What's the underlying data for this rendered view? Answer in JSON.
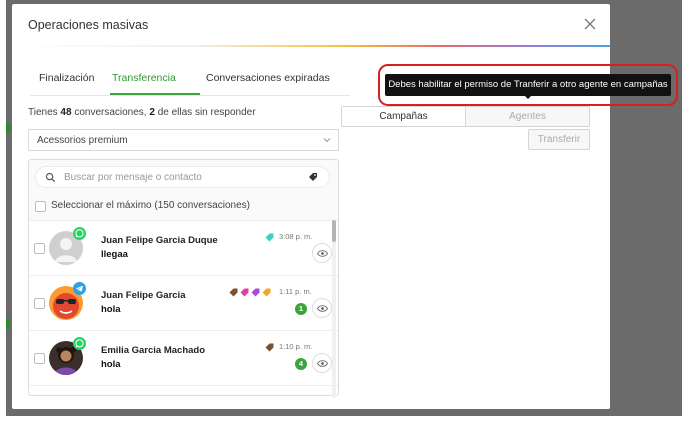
{
  "modal": {
    "title": "Operaciones masivas",
    "close_icon": "close-icon"
  },
  "tabs": [
    {
      "label": "Finalización",
      "active": false
    },
    {
      "label": "Transferencia",
      "active": true
    },
    {
      "label": "Conversaciones expiradas",
      "active": false
    }
  ],
  "summary": {
    "prefix": "Tienes ",
    "total": "48",
    "middle": " conversaciones, ",
    "unanswered": "2",
    "suffix": " de ellas sin responder"
  },
  "filter": {
    "selected": "Acessorios premium"
  },
  "search": {
    "placeholder": "Buscar por mensaje o contacto"
  },
  "select_all": {
    "label": "Seleccionar el máximo (150 conversaciones)"
  },
  "conversations": [
    {
      "name": "Juan Felipe Garcia Duque",
      "message": "llegaa",
      "time": "3:08 p. m.",
      "unread": "",
      "channel": "whatsapp",
      "avatar": "default-avatar",
      "tags": [
        "#3fd1c8"
      ]
    },
    {
      "name": "Juan Felipe Garcia",
      "message": "hola",
      "time": "1:11 p. m.",
      "unread": "1",
      "channel": "telegram",
      "avatar": "sunglasses-avatar",
      "tags": [
        "#7a5230",
        "#e040a0",
        "#a54be0",
        "#f2a623"
      ]
    },
    {
      "name": "Emilia Garcia Machado",
      "message": "hola",
      "time": "1:10 p. m.",
      "unread": "4",
      "channel": "whatsapp",
      "avatar": "photo-avatar",
      "tags": [
        "#7a5230"
      ]
    }
  ],
  "transfer": {
    "segment_campaigns": "Campañas",
    "segment_agents": "Agentes",
    "button": "Transferir",
    "tooltip": "Debes habilitar el permiso de Tranferir a otro agente en campañas"
  },
  "colors": {
    "accent_green": "#3aa63a",
    "whatsapp_green": "#25d366",
    "telegram_blue": "#2aa3e0",
    "highlight_red": "#d62020"
  }
}
